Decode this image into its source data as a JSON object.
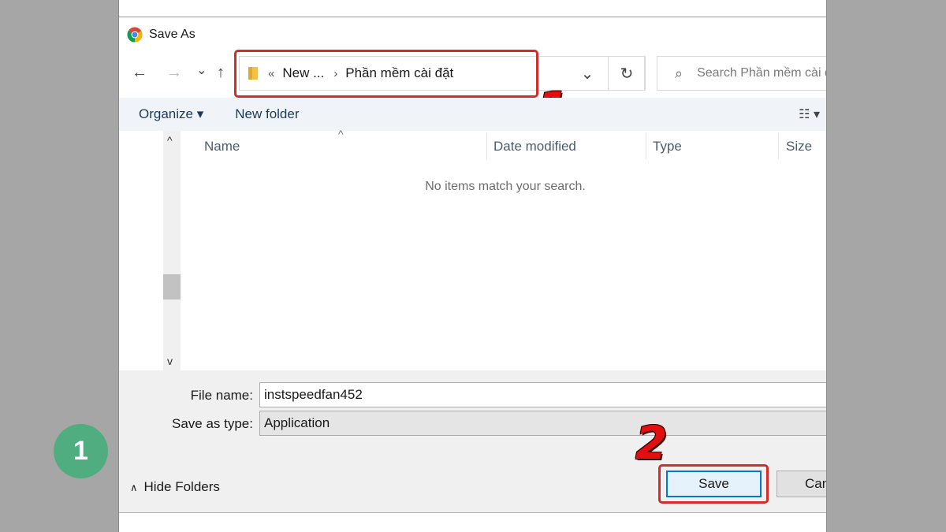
{
  "window": {
    "title": "Save As",
    "icon": "chrome-icon"
  },
  "nav": {
    "back": "←",
    "forward": "→",
    "recent": "⌄",
    "up": "↑"
  },
  "address": {
    "overflow": "«",
    "crumbs": [
      "New ...",
      "Phần mềm cài đặt"
    ],
    "separator": "›",
    "dropdown": "⌄",
    "refresh": "↻"
  },
  "search": {
    "placeholder": "Search Phần mềm cài đặt"
  },
  "toolbar": {
    "organize": "Organize ▾",
    "new_folder": "New folder",
    "view": "☷ ▾"
  },
  "columns": [
    "Name",
    "Date modified",
    "Type",
    "Size"
  ],
  "empty_message": "No items match your search.",
  "form": {
    "file_name_label": "File name:",
    "file_name_value": "instspeedfan452",
    "type_label": "Save as type:",
    "type_value": "Application"
  },
  "footer": {
    "hide_folders": "Hide Folders",
    "save": "Save",
    "cancel": "Cancel"
  },
  "annotations": {
    "marker1": "1",
    "marker2": "2",
    "step": "1"
  },
  "colors": {
    "annotation_red": "#d42b2b",
    "step_green": "#4fad80",
    "save_border": "#0078d7"
  }
}
